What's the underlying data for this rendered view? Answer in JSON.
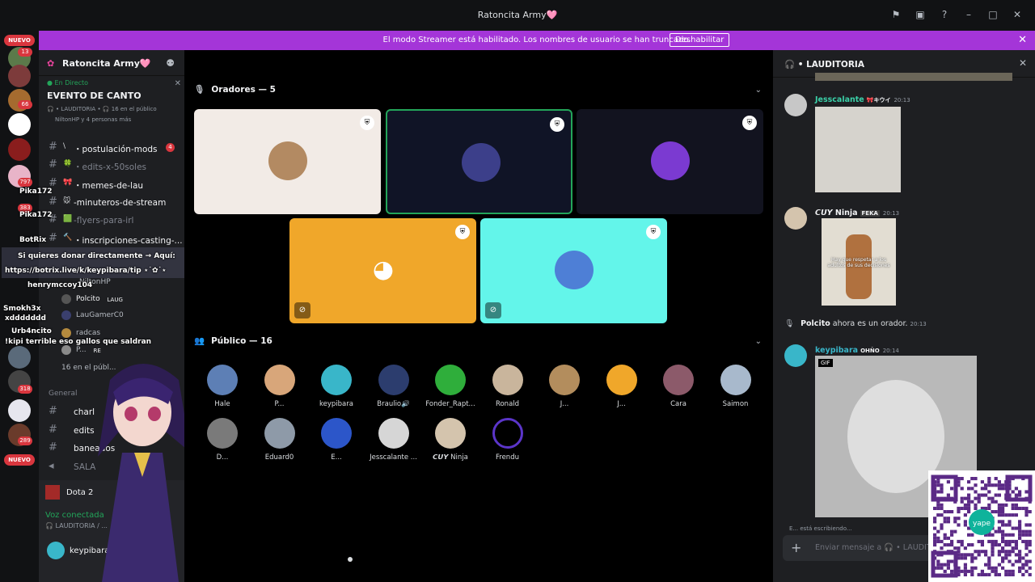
{
  "window": {
    "title": "Ratoncita Army🩷"
  },
  "banner": {
    "message": "El modo Streamer está habilitado. Los nombres de usuario se han truncado.",
    "button": "Deshabilitar"
  },
  "guild_rail": {
    "badges": [
      "13",
      "1",
      "66",
      "797",
      "383",
      "318",
      "289"
    ],
    "nuevo": "NUEVO"
  },
  "sidebar": {
    "server_name": "Ratoncita Army🩷",
    "live": {
      "tag": "● En Directo",
      "event": "EVENTO DE CANTO",
      "meta": "🎧 • LAUDITORIA • 🎧 16 en el público",
      "meta2": "NiltonHP y 4 personas más"
    },
    "channels": [
      {
        "emoji": "\\",
        "name": "・postulación-mods",
        "badge": "4",
        "muted": false
      },
      {
        "emoji": "🍀",
        "name": "・edits-x-50soles",
        "badge": "",
        "muted": true
      },
      {
        "emoji": "🎀",
        "name": "・memes-de-lau",
        "badge": "",
        "muted": false
      },
      {
        "emoji": "🐭",
        "name": "-minuteros-de-stream",
        "badge": "",
        "muted": false
      },
      {
        "emoji": "🟩",
        "name": "-flyers-para-irl",
        "badge": "",
        "muted": true
      },
      {
        "emoji": "🔨",
        "name": "・inscripciones-casting-...",
        "badge": "",
        "muted": false
      }
    ],
    "voice_users": [
      "NiltonHP",
      "Polcito",
      "LauGamerC0",
      "radcas",
      "P...",
      "16 en el públ..."
    ],
    "voice_tags": {
      "polcito": "LAUG",
      "p": "RE"
    },
    "lower_channels": [
      {
        "name": "charl"
      },
      {
        "name": "edits"
      },
      {
        "name": "baneados"
      },
      {
        "name": "SALA"
      }
    ],
    "general_label": "General",
    "panel": {
      "game": "Dota 2",
      "voice_status": "Voz conectada",
      "voice_channel": "🎧 LAUDITORIA / ...",
      "username": "keypibara"
    }
  },
  "overlay_chat": [
    {
      "name": "Pika172",
      "text": ""
    },
    {
      "name": "Pika172",
      "text": ""
    },
    {
      "name": "BotRix",
      "text": ""
    },
    {
      "name": "",
      "text": "Si quieres donar directamente → Aquí:"
    },
    {
      "name": "",
      "text": "https://botrix.live/k/keypibara/tip ⋆˙✿˙⋆"
    },
    {
      "name": "henrymccoy104",
      "text": ""
    },
    {
      "name": "Smokh3x",
      "text": ""
    },
    {
      "name": "",
      "text": "xddddddd"
    },
    {
      "name": "Urb4ncito",
      "text": ""
    },
    {
      "name": "",
      "text": "!kipi terrible eso gallos que saldran"
    }
  ],
  "stage": {
    "speakers_header": "Oradores — 5",
    "audience_header": "Público — 16",
    "speakers": [
      {
        "bg": "#f2ebe6",
        "av": "#b38a62",
        "muted": false,
        "selected": false
      },
      {
        "bg": "#101426",
        "av": "#3c3f8a",
        "muted": false,
        "selected": true
      },
      {
        "bg": "#12131f",
        "av": "#7b3ad1",
        "muted": false,
        "selected": false
      },
      {
        "bg": "#f0a72a",
        "av": "discord",
        "muted": true,
        "selected": false
      },
      {
        "bg": "#63f5ea",
        "av": "#4e7fd6",
        "muted": true,
        "selected": false
      }
    ],
    "audience": [
      {
        "name": "Hale",
        "color": "#5d7fb5"
      },
      {
        "name": "P...",
        "color": "#d8a67a"
      },
      {
        "name": "keypibara",
        "color": "#39b6c9"
      },
      {
        "name": "Braulio🔊",
        "color": "#2c3d6e"
      },
      {
        "name": "Fonder_Rapt...",
        "color": "#2fae3b"
      },
      {
        "name": "Ronald",
        "color": "#c9b59c"
      },
      {
        "name": "J...",
        "color": "#b38d5d"
      },
      {
        "name": "J...",
        "color": "#f0a72a"
      },
      {
        "name": "Cara",
        "color": "#8c5a6a"
      },
      {
        "name": "Saimon",
        "color": "#a8b9cc"
      },
      {
        "name": "D...",
        "color": "#7a7a7a"
      },
      {
        "name": "Eduard0",
        "color": "#8e9aa8"
      },
      {
        "name": "E...",
        "color": "#2c56c9"
      },
      {
        "name": "Jesscalante ...",
        "color": "#d6d6d6"
      },
      {
        "name": "𝘾𝙐𝙔 Ninja",
        "color": "#d4c4ad"
      },
      {
        "name": "Frendu",
        "color": "#5b35c9"
      }
    ]
  },
  "chat": {
    "title": "🎧 • LAUDITORIA",
    "messages": [
      {
        "user": "Jesscalante",
        "color": "#3ad0a8",
        "tag": "🎀キウイ",
        "time": "20:13",
        "av": "#c7c7c7"
      },
      {
        "user": "𝘾𝙐𝙔 Ninja",
        "color": "#f2f3f5",
        "tag": "FEKA",
        "time": "20:13",
        "av": "#d4c4ad"
      },
      {
        "user": "keypibara",
        "color": "#39b6c9",
        "tag": "OHÑO",
        "time": "20:14",
        "av": "#39b6c9"
      }
    ],
    "meme_caption": "Hay que respetar a los adultos de sus decisiones",
    "system": {
      "user": "Polcito",
      "text": "ahora es un orador.",
      "time": "20:13"
    },
    "gif_label": "GIF",
    "typing": "E... está escribiendo...",
    "placeholder": "Enviar mensaje a 🎧 • LAUDITORIA"
  },
  "qr": {
    "label": "yape"
  }
}
